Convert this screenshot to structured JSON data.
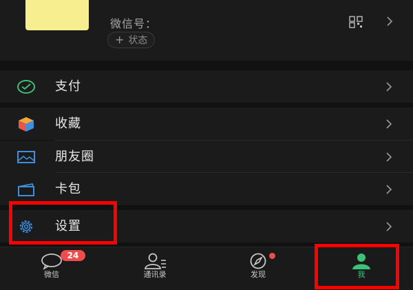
{
  "profile": {
    "wechat_id_label": "微信号：",
    "status_label": "状态"
  },
  "menu": {
    "pay": {
      "label": "支付",
      "icon": "pay-icon"
    },
    "favorites": {
      "label": "收藏",
      "icon": "favorites-cube-icon"
    },
    "moments": {
      "label": "朋友圈",
      "icon": "moments-picture-icon"
    },
    "cards": {
      "label": "卡包",
      "icon": "card-wallet-icon"
    },
    "settings": {
      "label": "设置",
      "icon": "gear-icon"
    }
  },
  "tabbar": {
    "chats": {
      "label": "微信",
      "badge": "24",
      "icon": "chat-bubble-icon"
    },
    "contacts": {
      "label": "通讯录",
      "icon": "contacts-icon"
    },
    "discover": {
      "label": "发现",
      "icon": "compass-icon"
    },
    "me": {
      "label": "我",
      "icon": "person-icon",
      "active": true
    }
  },
  "colors": {
    "background": "#111111",
    "row": "#1b1b1b",
    "accent_green": "#3fc07a",
    "badge_red": "#f04c4c",
    "annotation_red": "#ff0000",
    "avatar_yellow": "#f7ef8f"
  }
}
